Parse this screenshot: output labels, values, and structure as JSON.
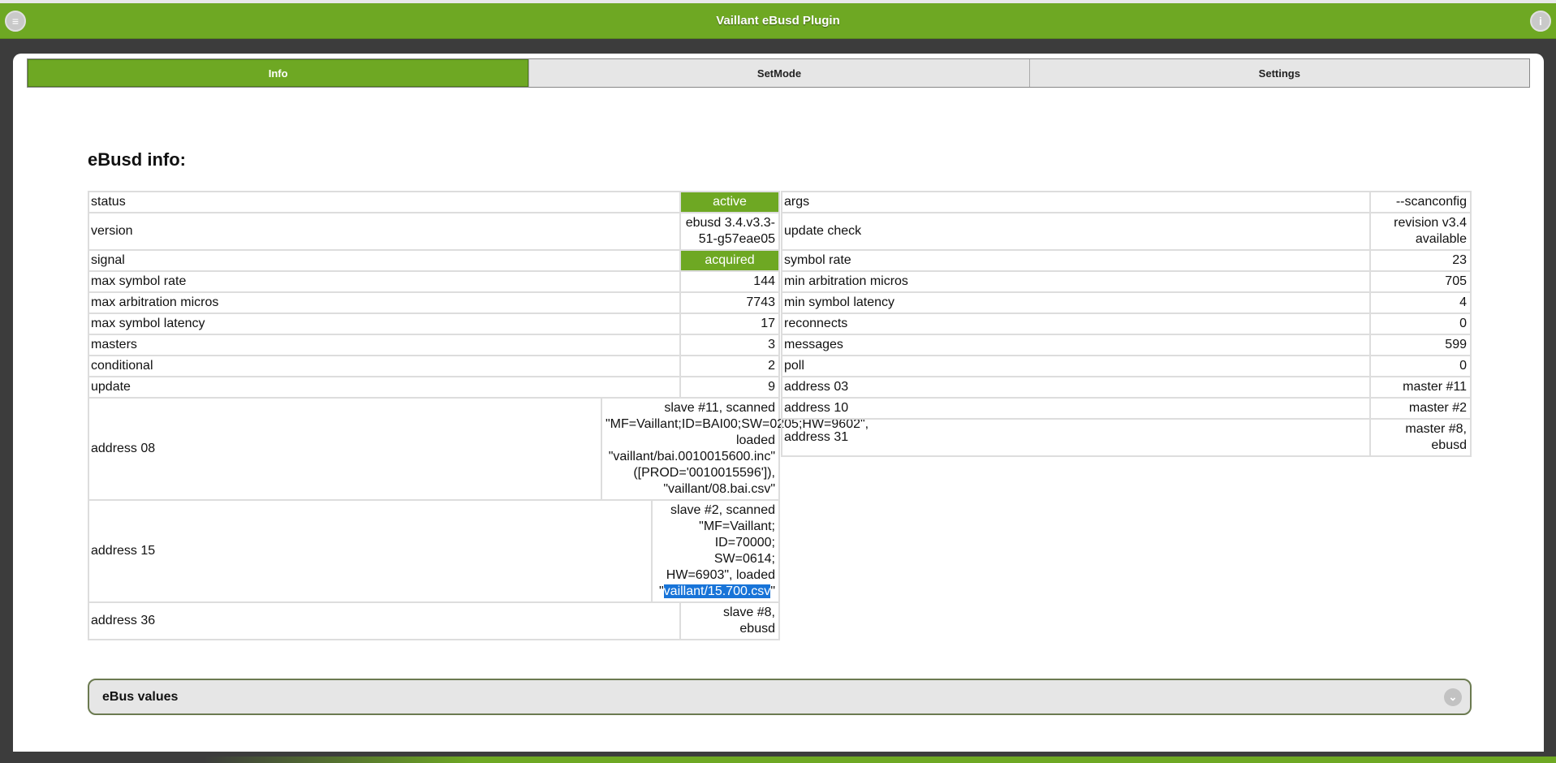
{
  "header": {
    "title": "Vaillant eBusd Plugin",
    "menu_icon": "menu-icon",
    "info_icon": "info-icon"
  },
  "tabs": [
    "Info",
    "SetMode",
    "Settings"
  ],
  "section_title": "eBusd info:",
  "left_rows": [
    {
      "label": "status",
      "value": "active"
    },
    {
      "label": "version",
      "value": "ebusd 3.4.v3.3-51-g57eae05"
    },
    {
      "label": "signal",
      "value": "acquired"
    },
    {
      "label": "max symbol rate",
      "value": "144"
    },
    {
      "label": "max arbitration micros",
      "value": "7743"
    },
    {
      "label": "max symbol latency",
      "value": "17"
    },
    {
      "label": "masters",
      "value": "3"
    },
    {
      "label": "conditional",
      "value": "2"
    },
    {
      "label": "update",
      "value": "9"
    },
    {
      "label": "address 08",
      "value": "slave #11, scanned \"MF=Vaillant;ID=BAI00;SW=0205;HW=9602\", loaded \"vaillant/bai.0010015600.inc\" ([PROD='0010015596']), \"vaillant/08.bai.csv\""
    },
    {
      "label": "address 15",
      "value_prefix": "slave #2, scanned \"MF=Vaillant; ID=70000; SW=0614; HW=6903\", loaded \"",
      "value_selected": "vaillant/15.700.csv",
      "value_suffix": "\""
    },
    {
      "label": "address 36",
      "value": "slave #8, ebusd"
    }
  ],
  "right_rows": [
    {
      "label": "args",
      "value": "--scanconfig"
    },
    {
      "label": "update check",
      "value": "revision v3.4 available"
    },
    {
      "label": "symbol rate",
      "value": "23"
    },
    {
      "label": "min arbitration micros",
      "value": "705"
    },
    {
      "label": "min symbol latency",
      "value": "4"
    },
    {
      "label": "reconnects",
      "value": "0"
    },
    {
      "label": "messages",
      "value": "599"
    },
    {
      "label": "poll",
      "value": "0"
    },
    {
      "label": "address 03",
      "value": "master #11"
    },
    {
      "label": "address 10",
      "value": "master #2"
    },
    {
      "label": "address 31",
      "value": "master #8, ebusd"
    }
  ],
  "accordion": {
    "label": "eBus values"
  },
  "colors": {
    "accent": "#6ea823",
    "dark": "#3c3c3c"
  }
}
